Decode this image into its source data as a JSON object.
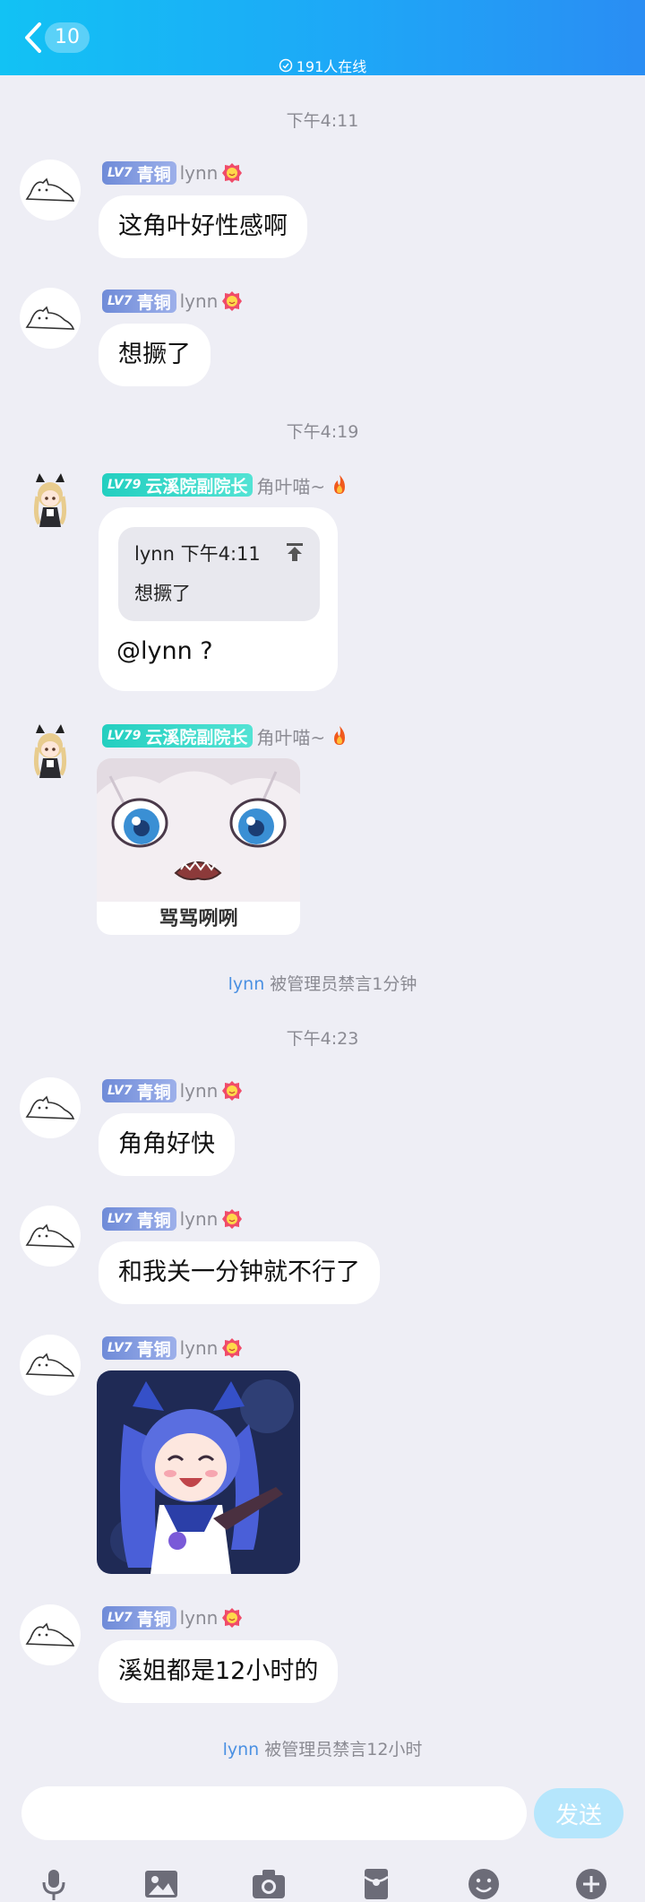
{
  "header": {
    "unread_count": "10",
    "online_text": "191人在线"
  },
  "chat": {
    "time_1": "下午4:11",
    "time_2": "下午4:19",
    "time_3": "下午4:23",
    "users": {
      "lynn": {
        "level": "LV7",
        "title": "青铜",
        "nickname": "lynn"
      },
      "jiaoye": {
        "level": "LV79",
        "title": "云溪院副院长",
        "nickname": "角叶喵~"
      }
    },
    "messages": [
      {
        "text": "这角叶好性感啊"
      },
      {
        "text": "想撅了"
      },
      {
        "quote_sender": "lynn",
        "quote_time": "下午4:11",
        "quote_text": "想撅了",
        "text": "@lynn ?"
      },
      {
        "sticker_caption": "骂骂咧咧"
      },
      {
        "text": "角角好快"
      },
      {
        "text": "和我关一分钟就不行了"
      },
      {
        "sticker": "anime-girl-pointing"
      },
      {
        "text": "溪姐都是12小时的"
      }
    ],
    "system_1": {
      "name": "lynn",
      "text": " 被管理员禁言1分钟"
    },
    "system_2": {
      "name": "lynn",
      "text": " 被管理员禁言12小时"
    }
  },
  "input": {
    "value": "",
    "placeholder": "",
    "send_label": "发送"
  },
  "toolbar": [
    "microphone-icon",
    "image-icon",
    "camera-icon",
    "red-packet-icon",
    "emoji-icon",
    "plus-icon"
  ],
  "colors": {
    "header_start": "#12c2f4",
    "header_end": "#2a8df3",
    "background": "#eeeef5",
    "system_name": "#4a90e2",
    "send_button": "#b5e6fc"
  }
}
